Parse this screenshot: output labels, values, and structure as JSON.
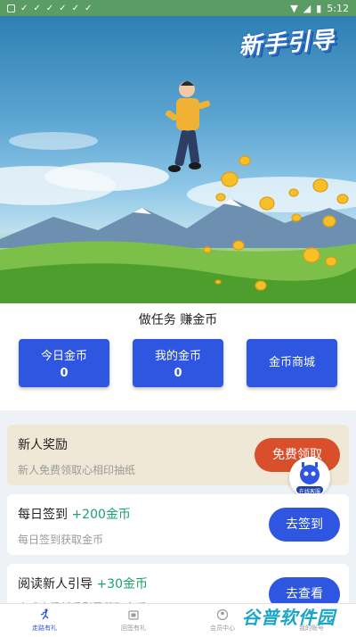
{
  "status_bar": {
    "time": "5:12"
  },
  "hero": {
    "badge_text": "新手引导"
  },
  "task_section": {
    "title": "做任务 赚金币"
  },
  "cards": [
    {
      "label": "今日金币",
      "value": "0"
    },
    {
      "label": "我的金币",
      "value": "0"
    },
    {
      "label": "金币商城"
    }
  ],
  "rewards": [
    {
      "title": "新人奖励",
      "subtitle": "新人免费领取心相印抽纸",
      "plus": "",
      "button": "免费领取"
    },
    {
      "title": "每日签到",
      "plus": "+200金币",
      "subtitle": "每日签到获取金币",
      "button": "去签到"
    },
    {
      "title": "阅读新人引导",
      "plus": "+30金币",
      "subtitle": "完成查看新手引导获取金币",
      "button": "去查看"
    }
  ],
  "nav": [
    {
      "label": "走路有礼",
      "active": true
    },
    {
      "label": "回签有礼",
      "active": false
    },
    {
      "label": "会员中心",
      "active": false
    },
    {
      "label": "我的账号",
      "active": false
    }
  ],
  "floating_widget": {
    "label": "在线客服"
  },
  "watermark": "谷普软件园",
  "colors": {
    "primary": "#2f56e0",
    "red_button": "#d94f2c",
    "green_plus": "#1aa36a",
    "status_bar": "#5a9c63"
  }
}
